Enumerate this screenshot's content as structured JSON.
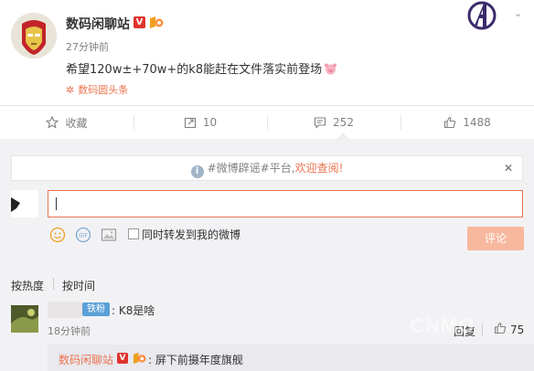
{
  "post": {
    "author": "数码闲聊站",
    "verified_badge": "V",
    "time": "27分钟前",
    "text": "希望120w±+70w+的k8能赶在文件落实前登场",
    "source": "数码圆头条"
  },
  "actions": {
    "favorite": "收藏",
    "repost": "10",
    "comment": "252",
    "like": "1488"
  },
  "notice": {
    "prefix": "#微博辟谣#平台,",
    "link": "欢迎查阅!",
    "close": "✕"
  },
  "composer": {
    "checkbox_label": "同时转发到我的微博",
    "submit": "评论"
  },
  "sort": {
    "hot": "按热度",
    "time": "按时间"
  },
  "comments": [
    {
      "badge": "铁粉",
      "text": ": K8是啥",
      "time": "18分钟前",
      "reply_label": "回复",
      "likes": "75",
      "reply": {
        "author": "数码闲聊站",
        "text": ": 屏下前摄年度旗舰"
      }
    }
  ],
  "watermark": "CNMO",
  "colors": {
    "accent": "#eb7350",
    "verified": "#e0322c",
    "badge_blue": "#5aa0d8",
    "muted": "#808080"
  },
  "icons": [
    "iron-man-avatar",
    "verified-icon",
    "fan-badge-icon",
    "avengers-logo-icon",
    "chevron-down-icon",
    "pig-emoji-icon",
    "source-icon",
    "star-icon",
    "repost-icon",
    "comment-icon",
    "like-icon",
    "info-icon",
    "close-icon",
    "emoji-icon",
    "gif-icon",
    "image-icon"
  ]
}
